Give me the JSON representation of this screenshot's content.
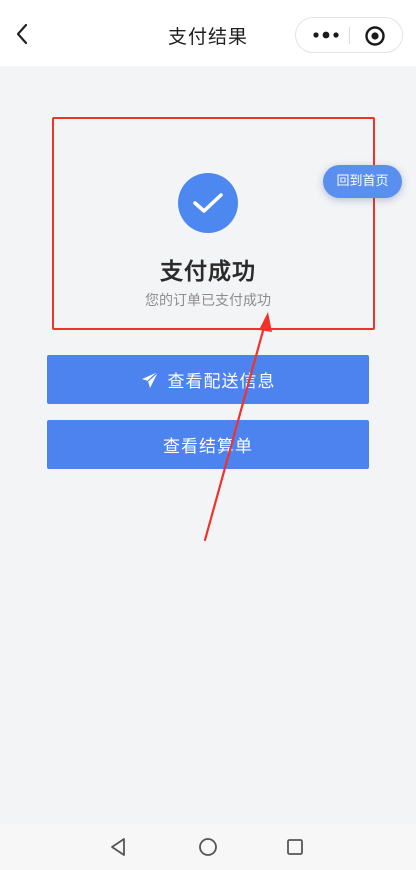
{
  "header": {
    "title": "支付结果"
  },
  "result": {
    "title": "支付成功",
    "description": "您的订单已支付成功"
  },
  "floating": {
    "home_label": "回到首页"
  },
  "actions": {
    "delivery_label": "查看配送信息",
    "statement_label": "查看结算单"
  },
  "icons": {
    "back": "chevron-left-icon",
    "more": "more-dots-icon",
    "close": "target-close-icon",
    "success": "check-icon",
    "plane": "paper-plane-icon",
    "nav_back": "triangle-back-icon",
    "nav_home": "circle-home-icon",
    "nav_recent": "square-recent-icon"
  },
  "colors": {
    "primary": "#4c83ef",
    "highlight_border": "#f0322a",
    "annotation": "#f0322a",
    "background": "#f3f4f6"
  }
}
